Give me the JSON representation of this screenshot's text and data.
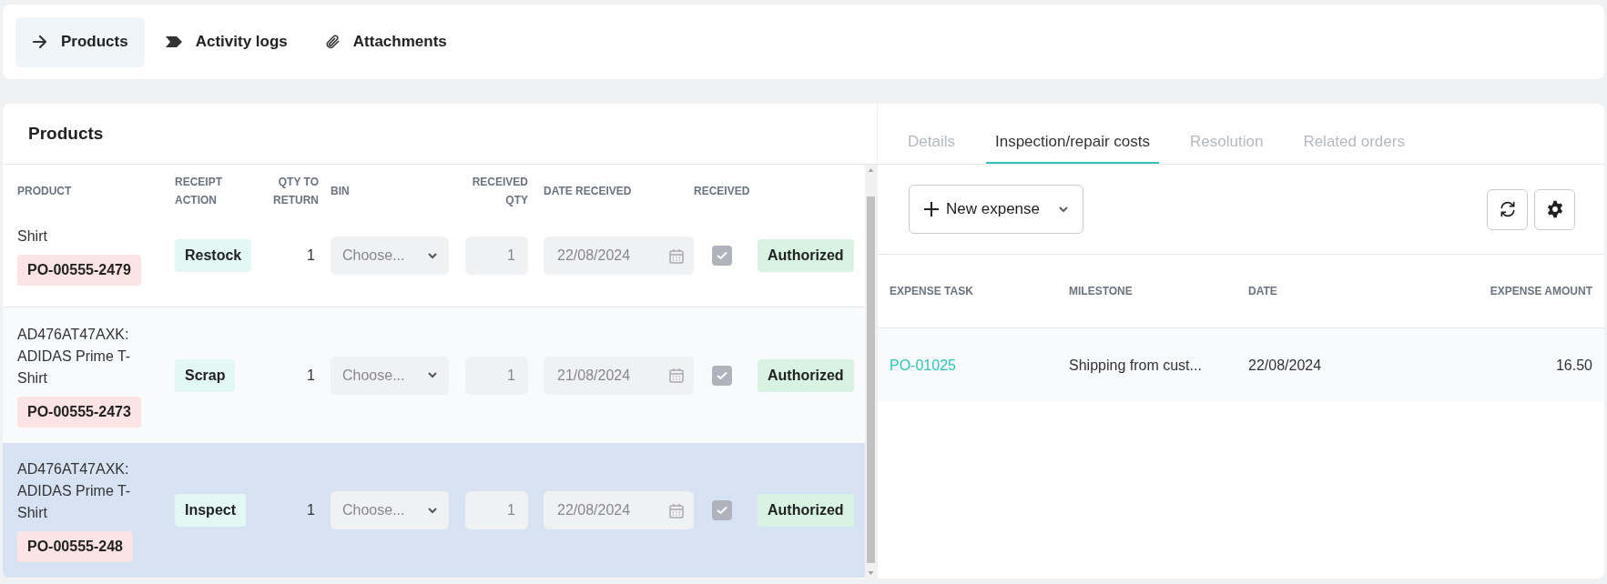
{
  "nav_tabs": [
    {
      "label": "Products",
      "kind": "arrow",
      "selected": true
    },
    {
      "label": "Activity logs",
      "kind": "chevron",
      "selected": false
    },
    {
      "label": "Attachments",
      "kind": "paperclip",
      "selected": false
    }
  ],
  "products_panel": {
    "title": "Products",
    "columns": [
      "PRODUCT",
      "RECEIPT ACTION",
      "QTY TO RETURN",
      "BIN",
      "RECEIVED QTY",
      "DATE RECEIVED",
      "RECEIVED"
    ],
    "rows": [
      {
        "product": "Shirt",
        "po": "PO-00555-2479",
        "receipt_action": "Restock",
        "qty_to_return": "1",
        "bin_placeholder": "Choose...",
        "received_qty": "1",
        "date_received": "22/08/2024",
        "received": true,
        "status": "Authorized",
        "selected": false
      },
      {
        "product": "AD476AT47AXK: ADIDAS Prime T-Shirt",
        "po": "PO-00555-2473",
        "receipt_action": "Scrap",
        "qty_to_return": "1",
        "bin_placeholder": "Choose...",
        "received_qty": "1",
        "date_received": "21/08/2024",
        "received": true,
        "status": "Authorized",
        "selected": false
      },
      {
        "product": "AD476AT47AXK: ADIDAS Prime T-Shirt",
        "po": "PO-00555-248",
        "receipt_action": "Inspect",
        "qty_to_return": "1",
        "bin_placeholder": "Choose...",
        "received_qty": "1",
        "date_received": "22/08/2024",
        "received": true,
        "status": "Authorized",
        "selected": true
      }
    ]
  },
  "detail_panel": {
    "tabs": [
      {
        "label": "Details",
        "selected": false
      },
      {
        "label": "Inspection/repair costs",
        "selected": true
      },
      {
        "label": "Resolution",
        "selected": false
      },
      {
        "label": "Related orders",
        "selected": false
      }
    ],
    "new_expense_button": "New expense",
    "columns": [
      "EXPENSE TASK",
      "MILESTONE",
      "DATE",
      "EXPENSE AMOUNT"
    ],
    "rows": [
      {
        "expense_task": "PO-01025",
        "milestone": "Shipping from cust...",
        "date": "22/08/2024",
        "expense_amount": "16.50"
      }
    ]
  }
}
